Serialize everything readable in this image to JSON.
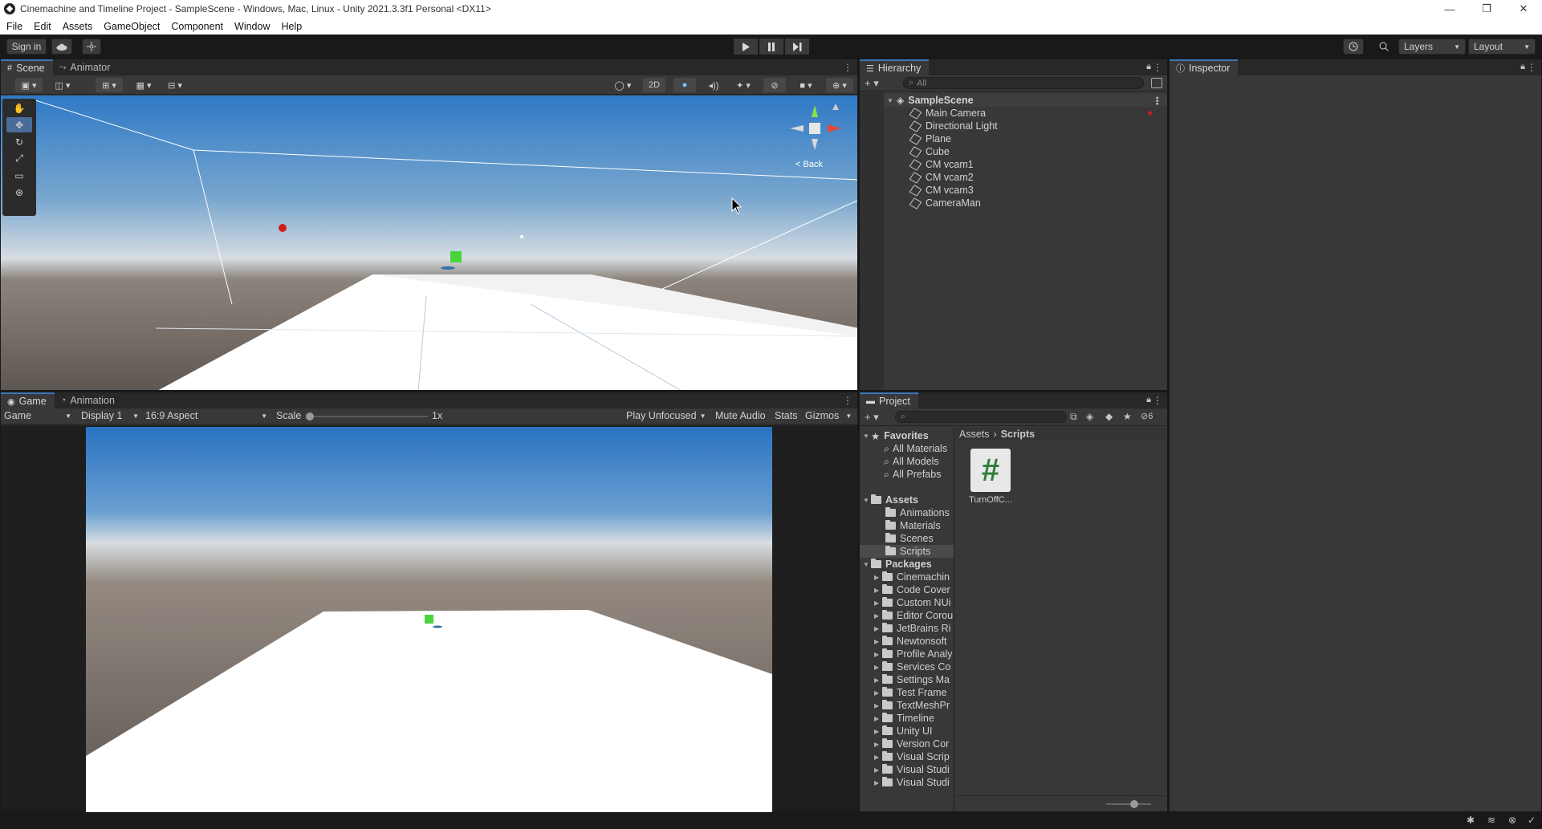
{
  "window": {
    "title": "Cinemachine and Timeline Project - SampleScene - Windows, Mac, Linux - Unity 2021.3.3f1 Personal <DX11>",
    "minimize": "—",
    "maximize": "❐",
    "close": "✕"
  },
  "menu": [
    "File",
    "Edit",
    "Assets",
    "GameObject",
    "Component",
    "Window",
    "Help"
  ],
  "toolbar": {
    "sign_in": "Sign in",
    "layers": "Layers",
    "layout": "Layout",
    "play_icon": "play-icon",
    "pause_icon": "pause-icon",
    "step_icon": "step-icon"
  },
  "scene_panel": {
    "tabs": [
      {
        "label": "Scene",
        "icon": "grid-icon",
        "active": true
      },
      {
        "label": "Animator",
        "icon": "animator-icon",
        "active": false
      }
    ],
    "toggle_2d": "2D",
    "gizmo_label": "< Back"
  },
  "game_panel": {
    "tabs": [
      {
        "label": "Game",
        "icon": "gamepad-icon",
        "active": true
      },
      {
        "label": "Animation",
        "icon": "animation-icon",
        "active": false
      }
    ],
    "game_dropdown": "Game",
    "display_dropdown": "Display 1",
    "aspect_dropdown": "16:9 Aspect",
    "scale_label": "Scale",
    "scale_value": "1x",
    "play_focus": "Play Unfocused",
    "mute_audio": "Mute Audio",
    "stats": "Stats",
    "gizmos": "Gizmos"
  },
  "hierarchy": {
    "tab": "Hierarchy",
    "search_placeholder": "All",
    "scene_name": "SampleScene",
    "items": [
      "Main Camera",
      "Directional Light",
      "Plane",
      "Cube",
      "CM vcam1",
      "CM vcam2",
      "CM vcam3",
      "CameraMan"
    ]
  },
  "inspector": {
    "tab": "Inspector"
  },
  "project": {
    "tab": "Project",
    "hidden_count": "6",
    "breadcrumb": [
      "Assets",
      "Scripts"
    ],
    "favorites_label": "Favorites",
    "favorites": [
      "All Materials",
      "All Models",
      "All Prefabs"
    ],
    "assets_label": "Assets",
    "assets": [
      "Animations",
      "Materials",
      "Scenes",
      "Scripts"
    ],
    "packages_label": "Packages",
    "packages": [
      "Cinemachin",
      "Code Cover",
      "Custom NUi",
      "Editor Corou",
      "JetBrains Ri",
      "Newtonsoft",
      "Profile Analy",
      "Services Co",
      "Settings Ma",
      "Test Frame",
      "TextMeshPr",
      "Timeline",
      "Unity UI",
      "Version Cor",
      "Visual Scrip",
      "Visual Studi",
      "Visual Studi"
    ],
    "files": [
      {
        "name": "TurnOffC...",
        "icon": "csharp-script-icon",
        "glyph": "#"
      }
    ]
  }
}
